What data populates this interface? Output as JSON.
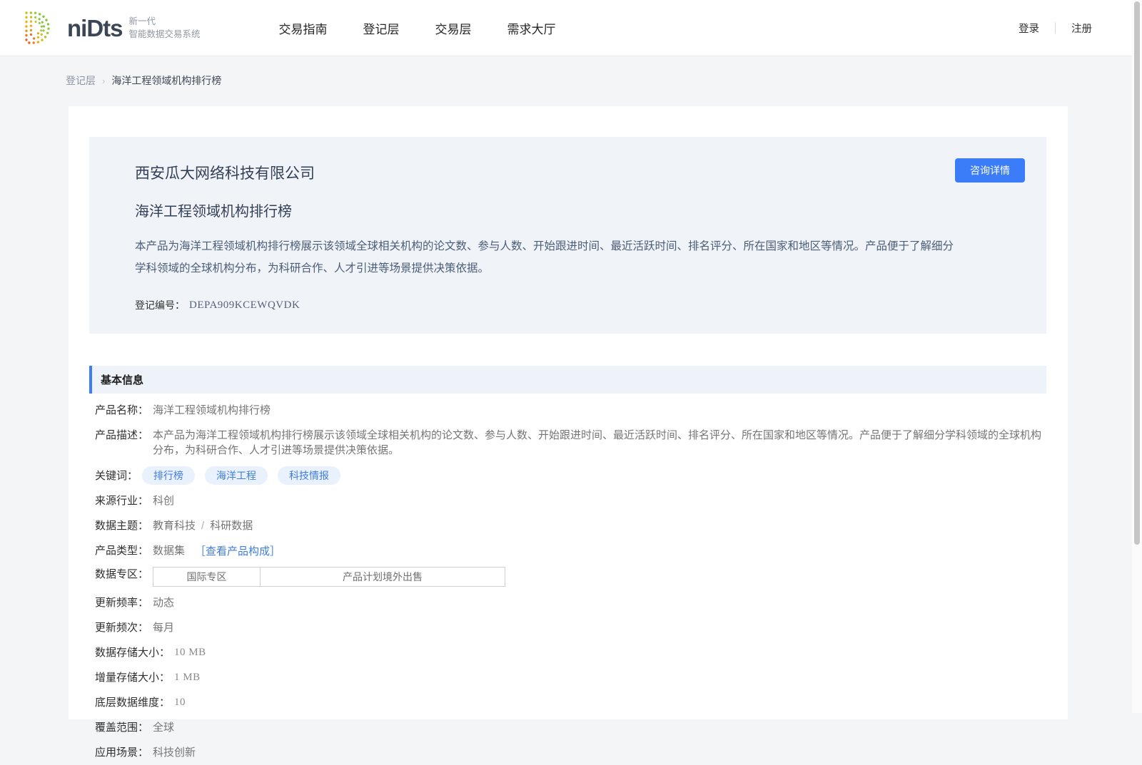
{
  "colors": {
    "accent_blue": "#3b7cf8",
    "tag_bg": "#e8f1fc",
    "tag_text": "#3f7de0",
    "hero_bg": "#f0f4f8",
    "section_header_bg": "#eef3f9",
    "page_bg": "#f4f5f6"
  },
  "brand": {
    "logo_icon": "dotted-d-logo",
    "wordmark": "niDts",
    "tagline_line1": "新一代",
    "tagline_line2": "智能数据交易系统"
  },
  "nav": {
    "items": [
      {
        "label": "交易指南"
      },
      {
        "label": "登记层"
      },
      {
        "label": "交易层"
      },
      {
        "label": "需求大厅"
      }
    ],
    "login": "登录",
    "register": "注册"
  },
  "breadcrumb": {
    "parent": "登记层",
    "separator": "›",
    "current": "海洋工程领域机构排行榜"
  },
  "hero": {
    "company": "西安瓜大网络科技有限公司",
    "title": "海洋工程领域机构排行榜",
    "description": "本产品为海洋工程领域机构排行榜展示该领域全球相关机构的论文数、参与人数、开始跟进时间、最近活跃时间、排名评分、所在国家和地区等情况。产品便于了解细分学科领域的全球机构分布，为科研合作、人才引进等场景提供决策依据。",
    "reg_label": "登记编号：",
    "reg_value": "DEPA909KCEWQVDK",
    "consult_button": "咨询详情"
  },
  "basic_info": {
    "section_title": "基本信息",
    "product_name": {
      "label": "产品名称：",
      "value": "海洋工程领域机构排行榜"
    },
    "product_desc": {
      "label": "产品描述：",
      "value": "本产品为海洋工程领域机构排行榜展示该领域全球相关机构的论文数、参与人数、开始跟进时间、最近活跃时间、排名评分、所在国家和地区等情况。产品便于了解细分学科领域的全球机构分布，为科研合作、人才引进等场景提供决策依据。"
    },
    "keywords": {
      "label": "关键词：",
      "tags": [
        "排行榜",
        "海洋工程",
        "科技情报"
      ]
    },
    "source_industry": {
      "label": "来源行业：",
      "value": "科创"
    },
    "data_topic": {
      "label": "数据主题：",
      "value1": "教育科技",
      "separator": "/",
      "value2": "科研数据"
    },
    "product_type": {
      "label": "产品类型：",
      "value": "数据集",
      "link": "［查看产品构成］"
    },
    "data_zone": {
      "label": "数据专区：",
      "cell1": "国际专区",
      "cell2": "产品计划境外出售"
    },
    "update_rate": {
      "label": "更新频率：",
      "value": "动态"
    },
    "update_times": {
      "label": "更新频次：",
      "value": "每月"
    },
    "storage_size": {
      "label": "数据存储大小：",
      "value": "10 MB"
    },
    "incremental_size": {
      "label": "增量存储大小：",
      "value": "1 MB"
    },
    "data_dimensions": {
      "label": "底层数据维度：",
      "value": "10"
    },
    "coverage": {
      "label": "覆盖范围：",
      "value": "全球"
    },
    "scenario": {
      "label": "应用场景：",
      "value": "科技创新"
    }
  }
}
